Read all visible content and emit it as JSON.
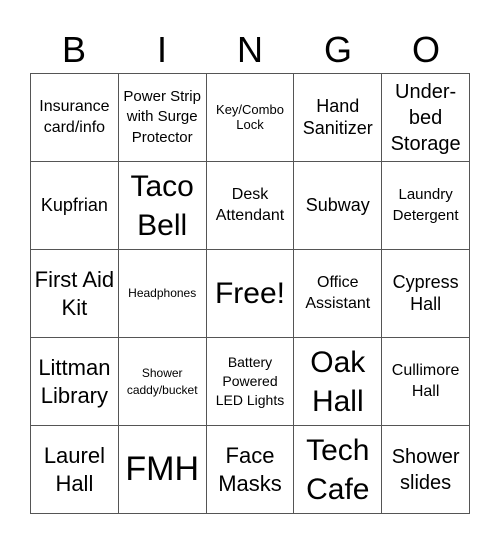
{
  "header": {
    "letters": [
      "B",
      "I",
      "N",
      "G",
      "O"
    ]
  },
  "grid": {
    "rows": [
      [
        "Insurance card/info",
        "Power Strip with Surge Protector",
        "Key/Combo Lock",
        "Hand Sanitizer",
        "Under-bed Storage"
      ],
      [
        "Kupfrian",
        "Taco Bell",
        "Desk Attendant",
        "Subway",
        "Laundry Detergent"
      ],
      [
        "First Aid Kit",
        "Headphones",
        "Free!",
        "Office Assistant",
        "Cypress Hall"
      ],
      [
        "Littman Library",
        "Shower caddy/bucket",
        "Battery Powered LED Lights",
        "Oak Hall",
        "Cullimore Hall"
      ],
      [
        "Laurel Hall",
        "FMH",
        "Face Masks",
        "Tech Cafe",
        "Shower slides"
      ]
    ]
  }
}
